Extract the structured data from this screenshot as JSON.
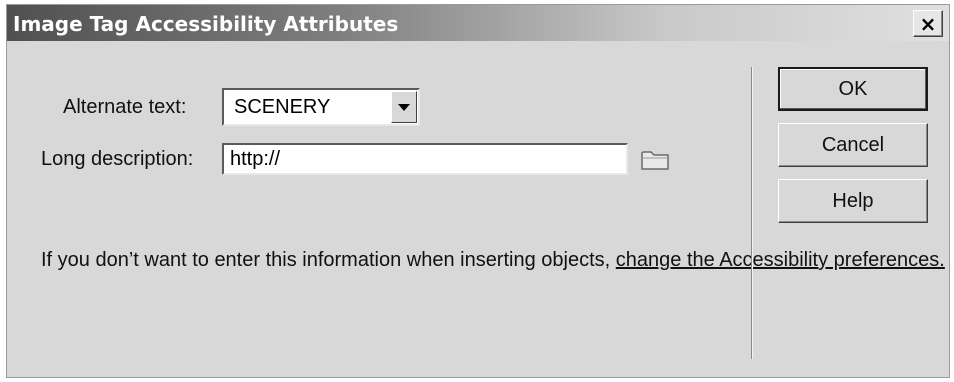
{
  "window": {
    "title": "Image Tag Accessibility Attributes",
    "close_label": "×"
  },
  "form": {
    "alt_label": "Alternate text:",
    "alt_value": "SCENERY",
    "long_label": "Long description:",
    "long_value": "http://",
    "browse_icon": "folder-icon"
  },
  "info": {
    "text": "If you don’t want to enter this information when inserting objects,",
    "link": "change the Accessibility preferences."
  },
  "buttons": {
    "ok": "OK",
    "cancel": "Cancel",
    "help": "Help"
  }
}
